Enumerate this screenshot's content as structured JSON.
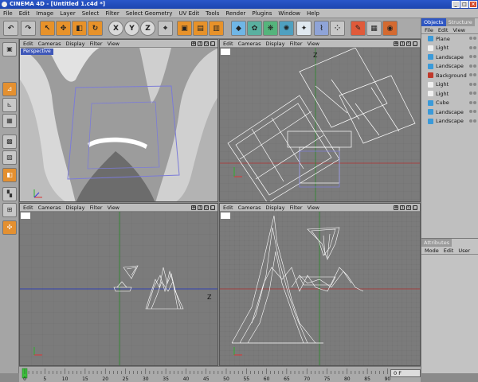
{
  "window": {
    "title": "CINEMA 4D - [Untitled 1.c4d *]"
  },
  "menus": [
    "File",
    "Edit",
    "Image",
    "Layer",
    "Select",
    "Filter",
    "Select Geometry",
    "UV Edit",
    "Tools",
    "Render",
    "Plugins",
    "Window",
    "Help"
  ],
  "toolbar": {
    "axis_x": "X",
    "axis_y": "Y",
    "axis_z": "Z"
  },
  "viewports": {
    "menu": [
      "Edit",
      "Cameras",
      "Display",
      "Filter",
      "View"
    ],
    "perspective_label": "Perspective",
    "top_axis": "Z",
    "front_axis": "Z"
  },
  "object_manager": {
    "tabs": [
      "Objects",
      "Structure"
    ],
    "menu": [
      "File",
      "Edit",
      "View"
    ],
    "objects": [
      {
        "name": "Plane",
        "icon_color": "#3a9ad9"
      },
      {
        "name": "Light",
        "icon_color": "#f0f0f0"
      },
      {
        "name": "Landscape",
        "icon_color": "#3a9ad9"
      },
      {
        "name": "Landscape",
        "icon_color": "#3a9ad9"
      },
      {
        "name": "Background",
        "icon_color": "#c0392b"
      },
      {
        "name": "Light",
        "icon_color": "#f0f0f0"
      },
      {
        "name": "Light",
        "icon_color": "#f0f0f0"
      },
      {
        "name": "Cube",
        "icon_color": "#3a9ad9"
      },
      {
        "name": "Landscape",
        "icon_color": "#3a9ad9"
      },
      {
        "name": "Landscape",
        "icon_color": "#3a9ad9"
      }
    ]
  },
  "attributes": {
    "title": "Attributes",
    "menu": [
      "Mode",
      "Edit",
      "User"
    ]
  },
  "timeline": {
    "ticks": [
      "0",
      "5",
      "10",
      "15",
      "20",
      "25",
      "30",
      "35",
      "40",
      "45",
      "50",
      "55",
      "60",
      "65",
      "70",
      "75",
      "80",
      "85",
      "90"
    ],
    "frame": "0 F"
  }
}
